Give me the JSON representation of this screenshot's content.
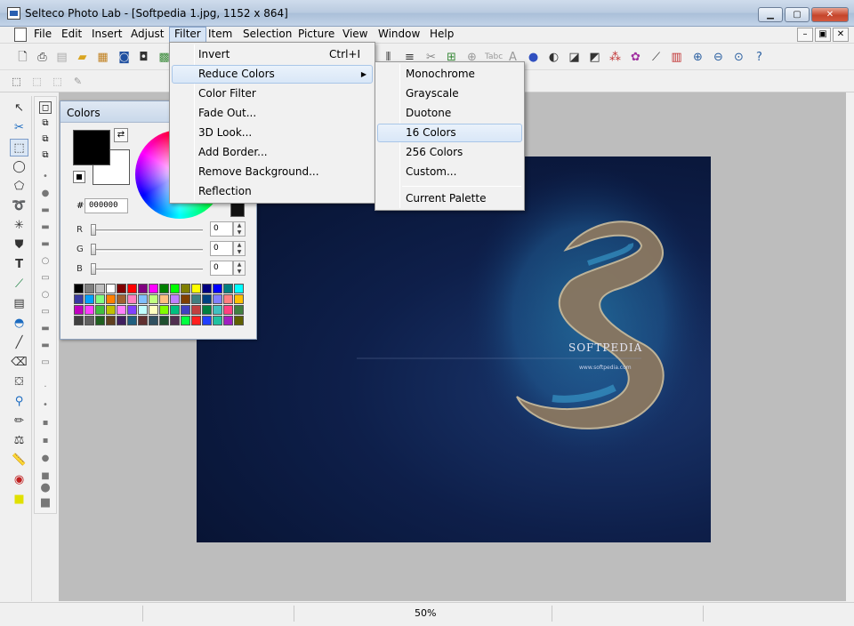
{
  "window": {
    "title": "Selteco Photo Lab - [Softpedia 1.jpg, 1152 x 864]",
    "minimize": "▁",
    "maximize": "▢",
    "close": "✕"
  },
  "menubar": {
    "items": [
      "File",
      "Edit",
      "Insert",
      "Adjust",
      "Filter",
      "Item",
      "Selection",
      "Picture",
      "View",
      "Window",
      "Help"
    ],
    "active": "Filter",
    "mdi": [
      "–",
      "▣",
      "✕"
    ]
  },
  "filter_menu": {
    "items": [
      {
        "label": "Invert",
        "shortcut": "Ctrl+I"
      },
      {
        "label": "Reduce Colors",
        "submenu": true
      },
      {
        "label": "Color Filter"
      },
      {
        "label": "Fade Out..."
      },
      {
        "label": "3D Look..."
      },
      {
        "label": "Add Border..."
      },
      {
        "label": "Remove Background..."
      },
      {
        "label": "Reflection"
      }
    ],
    "highlighted": "Reduce Colors",
    "submenu_arrow": "▶"
  },
  "reduce_colors_submenu": {
    "items": [
      "Monochrome",
      "Grayscale",
      "Duotone",
      "16 Colors",
      "256 Colors",
      "Custom...",
      "Current Palette"
    ],
    "highlighted": "16 Colors"
  },
  "colors_panel": {
    "title": "Colors",
    "hash": "#",
    "hex": "000000",
    "channels": [
      {
        "label": "R",
        "value": "0"
      },
      {
        "label": "G",
        "value": "0"
      },
      {
        "label": "B",
        "value": "0"
      }
    ],
    "foreground": "#000000",
    "background": "#ffffff",
    "palette": [
      "#000000",
      "#808080",
      "#c0c0c0",
      "#ffffff",
      "#800000",
      "#ff0000",
      "#800080",
      "#ff00ff",
      "#008000",
      "#00ff00",
      "#808000",
      "#ffff00",
      "#000080",
      "#0000ff",
      "#008080",
      "#00ffff",
      "#3a3aa0",
      "#00a0ff",
      "#80ff80",
      "#ff8000",
      "#a06030",
      "#ff80c0",
      "#80c0ff",
      "#c0ff80",
      "#ffc080",
      "#c080ff",
      "#804000",
      "#408080",
      "#004080",
      "#8080ff",
      "#ff8080",
      "#ffc000",
      "#c000c0",
      "#ff40ff",
      "#40c040",
      "#c0c000",
      "#ff80ff",
      "#8040ff",
      "#c0ffff",
      "#ffffc0",
      "#80ff00",
      "#00c080",
      "#4040c0",
      "#c04040",
      "#008040",
      "#40c0c0",
      "#ff4080",
      "#408040",
      "#404040",
      "#606060",
      "#206020",
      "#604020",
      "#402060",
      "#206080",
      "#603030",
      "#305060",
      "#205030",
      "#503050",
      "#00ff40",
      "#ff2020",
      "#2040ff",
      "#20c0a0",
      "#a020c0",
      "#606000"
    ]
  },
  "image": {
    "brand": "SOFTPEDIA",
    "url": "www.softpedia.com"
  },
  "status": {
    "zoom": "50%"
  },
  "watermark": "SOFTPEDIA"
}
